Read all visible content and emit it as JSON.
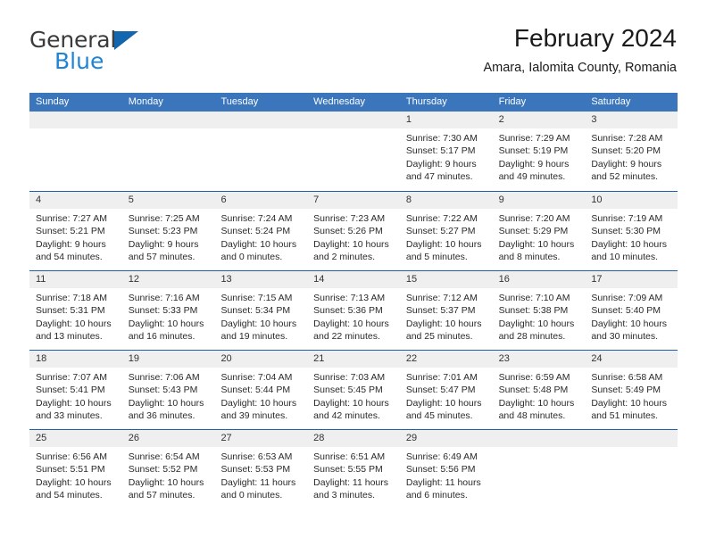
{
  "brand": {
    "line1": "General",
    "line2": "Blue",
    "flag_icon": "triangle-flag-icon",
    "color_dark": "#3b3b3b",
    "color_blue": "#1f84d6"
  },
  "header": {
    "title": "February 2024",
    "subtitle": "Amara, Ialomita County, Romania"
  },
  "theme": {
    "header_bar": "#3b76bc",
    "row_divider": "#1d60a8",
    "day_band": "#efefef",
    "text": "#2a2a2a"
  },
  "calendar": {
    "weekday_headers": [
      "Sunday",
      "Monday",
      "Tuesday",
      "Wednesday",
      "Thursday",
      "Friday",
      "Saturday"
    ],
    "weeks": [
      [
        {
          "day": "",
          "blank": true
        },
        {
          "day": "",
          "blank": true
        },
        {
          "day": "",
          "blank": true
        },
        {
          "day": "",
          "blank": true
        },
        {
          "day": "1",
          "sunrise": "Sunrise: 7:30 AM",
          "sunset": "Sunset: 5:17 PM",
          "daylight_line1": "Daylight: 9 hours",
          "daylight_line2": "and 47 minutes."
        },
        {
          "day": "2",
          "sunrise": "Sunrise: 7:29 AM",
          "sunset": "Sunset: 5:19 PM",
          "daylight_line1": "Daylight: 9 hours",
          "daylight_line2": "and 49 minutes."
        },
        {
          "day": "3",
          "sunrise": "Sunrise: 7:28 AM",
          "sunset": "Sunset: 5:20 PM",
          "daylight_line1": "Daylight: 9 hours",
          "daylight_line2": "and 52 minutes."
        }
      ],
      [
        {
          "day": "4",
          "sunrise": "Sunrise: 7:27 AM",
          "sunset": "Sunset: 5:21 PM",
          "daylight_line1": "Daylight: 9 hours",
          "daylight_line2": "and 54 minutes."
        },
        {
          "day": "5",
          "sunrise": "Sunrise: 7:25 AM",
          "sunset": "Sunset: 5:23 PM",
          "daylight_line1": "Daylight: 9 hours",
          "daylight_line2": "and 57 minutes."
        },
        {
          "day": "6",
          "sunrise": "Sunrise: 7:24 AM",
          "sunset": "Sunset: 5:24 PM",
          "daylight_line1": "Daylight: 10 hours",
          "daylight_line2": "and 0 minutes."
        },
        {
          "day": "7",
          "sunrise": "Sunrise: 7:23 AM",
          "sunset": "Sunset: 5:26 PM",
          "daylight_line1": "Daylight: 10 hours",
          "daylight_line2": "and 2 minutes."
        },
        {
          "day": "8",
          "sunrise": "Sunrise: 7:22 AM",
          "sunset": "Sunset: 5:27 PM",
          "daylight_line1": "Daylight: 10 hours",
          "daylight_line2": "and 5 minutes."
        },
        {
          "day": "9",
          "sunrise": "Sunrise: 7:20 AM",
          "sunset": "Sunset: 5:29 PM",
          "daylight_line1": "Daylight: 10 hours",
          "daylight_line2": "and 8 minutes."
        },
        {
          "day": "10",
          "sunrise": "Sunrise: 7:19 AM",
          "sunset": "Sunset: 5:30 PM",
          "daylight_line1": "Daylight: 10 hours",
          "daylight_line2": "and 10 minutes."
        }
      ],
      [
        {
          "day": "11",
          "sunrise": "Sunrise: 7:18 AM",
          "sunset": "Sunset: 5:31 PM",
          "daylight_line1": "Daylight: 10 hours",
          "daylight_line2": "and 13 minutes."
        },
        {
          "day": "12",
          "sunrise": "Sunrise: 7:16 AM",
          "sunset": "Sunset: 5:33 PM",
          "daylight_line1": "Daylight: 10 hours",
          "daylight_line2": "and 16 minutes."
        },
        {
          "day": "13",
          "sunrise": "Sunrise: 7:15 AM",
          "sunset": "Sunset: 5:34 PM",
          "daylight_line1": "Daylight: 10 hours",
          "daylight_line2": "and 19 minutes."
        },
        {
          "day": "14",
          "sunrise": "Sunrise: 7:13 AM",
          "sunset": "Sunset: 5:36 PM",
          "daylight_line1": "Daylight: 10 hours",
          "daylight_line2": "and 22 minutes."
        },
        {
          "day": "15",
          "sunrise": "Sunrise: 7:12 AM",
          "sunset": "Sunset: 5:37 PM",
          "daylight_line1": "Daylight: 10 hours",
          "daylight_line2": "and 25 minutes."
        },
        {
          "day": "16",
          "sunrise": "Sunrise: 7:10 AM",
          "sunset": "Sunset: 5:38 PM",
          "daylight_line1": "Daylight: 10 hours",
          "daylight_line2": "and 28 minutes."
        },
        {
          "day": "17",
          "sunrise": "Sunrise: 7:09 AM",
          "sunset": "Sunset: 5:40 PM",
          "daylight_line1": "Daylight: 10 hours",
          "daylight_line2": "and 30 minutes."
        }
      ],
      [
        {
          "day": "18",
          "sunrise": "Sunrise: 7:07 AM",
          "sunset": "Sunset: 5:41 PM",
          "daylight_line1": "Daylight: 10 hours",
          "daylight_line2": "and 33 minutes."
        },
        {
          "day": "19",
          "sunrise": "Sunrise: 7:06 AM",
          "sunset": "Sunset: 5:43 PM",
          "daylight_line1": "Daylight: 10 hours",
          "daylight_line2": "and 36 minutes."
        },
        {
          "day": "20",
          "sunrise": "Sunrise: 7:04 AM",
          "sunset": "Sunset: 5:44 PM",
          "daylight_line1": "Daylight: 10 hours",
          "daylight_line2": "and 39 minutes."
        },
        {
          "day": "21",
          "sunrise": "Sunrise: 7:03 AM",
          "sunset": "Sunset: 5:45 PM",
          "daylight_line1": "Daylight: 10 hours",
          "daylight_line2": "and 42 minutes."
        },
        {
          "day": "22",
          "sunrise": "Sunrise: 7:01 AM",
          "sunset": "Sunset: 5:47 PM",
          "daylight_line1": "Daylight: 10 hours",
          "daylight_line2": "and 45 minutes."
        },
        {
          "day": "23",
          "sunrise": "Sunrise: 6:59 AM",
          "sunset": "Sunset: 5:48 PM",
          "daylight_line1": "Daylight: 10 hours",
          "daylight_line2": "and 48 minutes."
        },
        {
          "day": "24",
          "sunrise": "Sunrise: 6:58 AM",
          "sunset": "Sunset: 5:49 PM",
          "daylight_line1": "Daylight: 10 hours",
          "daylight_line2": "and 51 minutes."
        }
      ],
      [
        {
          "day": "25",
          "sunrise": "Sunrise: 6:56 AM",
          "sunset": "Sunset: 5:51 PM",
          "daylight_line1": "Daylight: 10 hours",
          "daylight_line2": "and 54 minutes."
        },
        {
          "day": "26",
          "sunrise": "Sunrise: 6:54 AM",
          "sunset": "Sunset: 5:52 PM",
          "daylight_line1": "Daylight: 10 hours",
          "daylight_line2": "and 57 minutes."
        },
        {
          "day": "27",
          "sunrise": "Sunrise: 6:53 AM",
          "sunset": "Sunset: 5:53 PM",
          "daylight_line1": "Daylight: 11 hours",
          "daylight_line2": "and 0 minutes."
        },
        {
          "day": "28",
          "sunrise": "Sunrise: 6:51 AM",
          "sunset": "Sunset: 5:55 PM",
          "daylight_line1": "Daylight: 11 hours",
          "daylight_line2": "and 3 minutes."
        },
        {
          "day": "29",
          "sunrise": "Sunrise: 6:49 AM",
          "sunset": "Sunset: 5:56 PM",
          "daylight_line1": "Daylight: 11 hours",
          "daylight_line2": "and 6 minutes."
        },
        {
          "day": "",
          "blank": true
        },
        {
          "day": "",
          "blank": true
        }
      ]
    ]
  }
}
